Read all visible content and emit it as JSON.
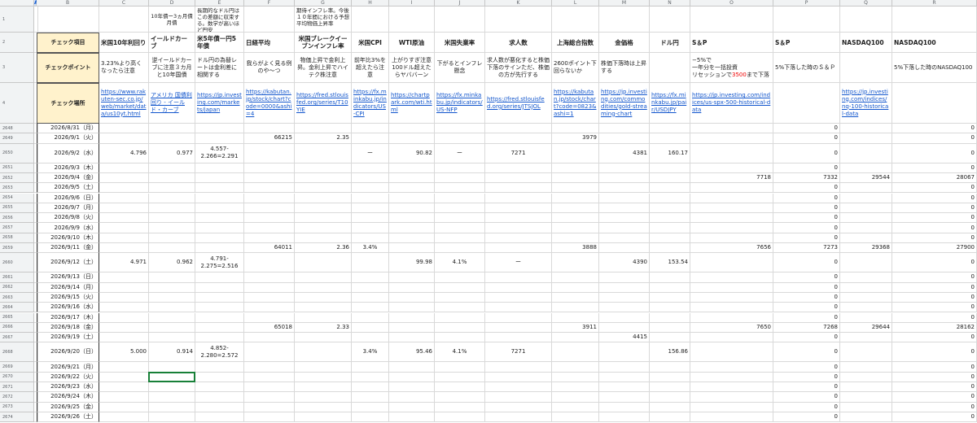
{
  "columns": [
    "A",
    "B",
    "C",
    "D",
    "E",
    "F",
    "G",
    "H",
    "I",
    "J",
    "K",
    "L",
    "M",
    "N",
    "O",
    "P",
    "Q",
    "R"
  ],
  "selected_column": "A",
  "row_numbers": [
    "1",
    "2",
    "3",
    "4",
    "2648",
    "2649",
    "2650",
    "2651",
    "2652",
    "2653",
    "2654",
    "2655",
    "2656",
    "2657",
    "2658",
    "2659",
    "2660",
    "2661",
    "2662",
    "2663",
    "2664",
    "2665",
    "2666",
    "2667",
    "2668",
    "2669",
    "2670",
    "2671",
    "2672",
    "2673",
    "2674"
  ],
  "top_notes": {
    "d": "10年債ー3ヵ月債月債",
    "e": "長期的なドル円はこの差額に収束する。数学が高いほど円安",
    "g": "期待インフレ率。今後１０年間における予想平均物価上昇率"
  },
  "headers": {
    "b": "チェック項目",
    "c": "米国10年利回り",
    "d": "イールドカーブ",
    "e": "米5年債ー円5年債",
    "f": "日経平均",
    "g": "米国ブレークイーブンインフレ率",
    "h": "米国CPI",
    "i": "WTI原油",
    "j": "米国失業率",
    "k": "求人数",
    "l": "上海総合指数",
    "m": "金価格",
    "n": "ドル円",
    "o": "S＆P",
    "p": "S＆P",
    "q": "NASDAQ100",
    "r": "NASDAQ100"
  },
  "points": {
    "b": "チェックポイント",
    "c": "3.23%より高くなったら注意",
    "d": "逆イールドカーブに注意３カ月と10年国債",
    "e": "ドル円の為替レートは金利差に相関する",
    "f": "我らがよく見る例のや〜つ",
    "g": "物価上昇で金利上昇。金利上昇でハイテク株注意",
    "h": "前年比3%を超えたら注意",
    "i": "上がりすぎ注意100ドル超えたらヤババーン",
    "j": "下がるとインフレ懸念",
    "k": "求人数が悪化すると株価下落のサインただ、株価の方が先行する",
    "l": "2600ポイント下回らないか",
    "m": "株価下落時は上昇する",
    "n": "",
    "o_line1": "−5%で",
    "o_line2": "一年分を一括投資",
    "o_line3a": "リセッションで",
    "o_line3b": "3500",
    "o_line3c": "まで下落",
    "p": "5%下落した時のＳ＆Ｐ",
    "q": "",
    "r": "5%下落した時のNASDAQ100"
  },
  "places": {
    "b": "チェック場所",
    "c": "https://www.rakuten-sec.co.jp/web/market/data/us10yt.html",
    "d": "アメリカ 国債利回り - イールド・カーブ",
    "e": "https://jp.investing.com/markets/japan",
    "f": "https://kabutan.jp/stock/chart?code=0000&ashi=4",
    "g": "https://fred.stlouisfed.org/series/T10YIE",
    "h": "https://fx.minkabu.jp/indicators/US-CPI",
    "i": "https://chartpark.com/wti.html",
    "j": "https://fx.minkabu.jp/indicators/US-NFP",
    "k": "https://fred.stlouisfed.org/series/JTSJOL",
    "l": "https://kabutan.jp/stock/chart?code=0823&ashi=1",
    "m": "https://jp.investing.com/commodities/gold-streaming-chart",
    "n": "https://fx.minkabu.jp/pair/USDJPY",
    "o": "https://jp.investing.com/indices/us-spx-500-historical-data",
    "p": "",
    "q": "https://jp.investing.com/indices/nq-100-historical-data",
    "r": ""
  },
  "rows": [
    {
      "date": "2026/8/31（月）",
      "c": "",
      "d": "",
      "e": "",
      "f": "",
      "g": "",
      "h": "",
      "i": "",
      "j": "",
      "k": "",
      "l": "",
      "m": "",
      "n": "",
      "o": "",
      "p": "0",
      "q": "",
      "r": "0"
    },
    {
      "date": "2026/9/1（火）",
      "c": "",
      "d": "",
      "e": "",
      "f": "66215",
      "g": "2.35",
      "h": "",
      "i": "",
      "j": "",
      "k": "",
      "l": "3979",
      "m": "",
      "n": "",
      "o": "",
      "p": "0",
      "q": "",
      "r": "0"
    },
    {
      "date": "2026/9/2（水）",
      "c": "4.796",
      "d": "0.977",
      "e": "4.557-2.266=2.291",
      "f": "",
      "g": "",
      "h": "ー",
      "i": "90.82",
      "j": "ー",
      "k": "7271",
      "l": "",
      "m": "4381",
      "n": "160.17",
      "o": "",
      "p": "0",
      "q": "",
      "r": "0"
    },
    {
      "date": "2026/9/3（木）",
      "c": "",
      "d": "",
      "e": "",
      "f": "",
      "g": "",
      "h": "",
      "i": "",
      "j": "",
      "k": "",
      "l": "",
      "m": "",
      "n": "",
      "o": "",
      "p": "0",
      "q": "",
      "r": "0"
    },
    {
      "date": "2026/9/4（金）",
      "c": "",
      "d": "",
      "e": "",
      "f": "",
      "g": "",
      "h": "",
      "i": "",
      "j": "",
      "k": "",
      "l": "",
      "m": "",
      "n": "",
      "o": "7718",
      "p": "7332",
      "q": "29544",
      "r": "28067"
    },
    {
      "date": "2026/9/5（土）",
      "c": "",
      "d": "",
      "e": "",
      "f": "",
      "g": "",
      "h": "",
      "i": "",
      "j": "",
      "k": "",
      "l": "",
      "m": "",
      "n": "",
      "o": "",
      "p": "0",
      "q": "",
      "r": "0"
    },
    {
      "date": "2026/9/6（日）",
      "c": "",
      "d": "",
      "e": "",
      "f": "",
      "g": "",
      "h": "",
      "i": "",
      "j": "",
      "k": "",
      "l": "",
      "m": "",
      "n": "",
      "o": "",
      "p": "0",
      "q": "",
      "r": "0"
    },
    {
      "date": "2026/9/7（月）",
      "c": "",
      "d": "",
      "e": "",
      "f": "",
      "g": "",
      "h": "",
      "i": "",
      "j": "",
      "k": "",
      "l": "",
      "m": "",
      "n": "",
      "o": "",
      "p": "0",
      "q": "",
      "r": "0"
    },
    {
      "date": "2026/9/8（火）",
      "c": "",
      "d": "",
      "e": "",
      "f": "",
      "g": "",
      "h": "",
      "i": "",
      "j": "",
      "k": "",
      "l": "",
      "m": "",
      "n": "",
      "o": "",
      "p": "0",
      "q": "",
      "r": "0"
    },
    {
      "date": "2026/9/9（水）",
      "c": "",
      "d": "",
      "e": "",
      "f": "",
      "g": "",
      "h": "",
      "i": "",
      "j": "",
      "k": "",
      "l": "",
      "m": "",
      "n": "",
      "o": "",
      "p": "0",
      "q": "",
      "r": "0"
    },
    {
      "date": "2026/9/10（木）",
      "c": "",
      "d": "",
      "e": "",
      "f": "",
      "g": "",
      "h": "",
      "i": "",
      "j": "",
      "k": "",
      "l": "",
      "m": "",
      "n": "",
      "o": "",
      "p": "0",
      "q": "",
      "r": "0"
    },
    {
      "date": "2026/9/11（金）",
      "c": "",
      "d": "",
      "e": "",
      "f": "64011",
      "g": "2.36",
      "h": "3.4%",
      "i": "",
      "j": "",
      "k": "",
      "l": "3888",
      "m": "",
      "n": "",
      "o": "7656",
      "p": "7273",
      "q": "29368",
      "r": "27900"
    },
    {
      "date": "2026/9/12（土）",
      "c": "4.971",
      "d": "0.962",
      "e": "4.791-2.275=2.516",
      "f": "",
      "g": "",
      "h": "",
      "i": "99.98",
      "j": "4.1%",
      "k": "ー",
      "l": "",
      "m": "4390",
      "n": "153.54",
      "o": "",
      "p": "0",
      "q": "",
      "r": "0"
    },
    {
      "date": "2026/9/13（日）",
      "c": "",
      "d": "",
      "e": "",
      "f": "",
      "g": "",
      "h": "",
      "i": "",
      "j": "",
      "k": "",
      "l": "",
      "m": "",
      "n": "",
      "o": "",
      "p": "0",
      "q": "",
      "r": "0"
    },
    {
      "date": "2026/9/14（月）",
      "c": "",
      "d": "",
      "e": "",
      "f": "",
      "g": "",
      "h": "",
      "i": "",
      "j": "",
      "k": "",
      "l": "",
      "m": "",
      "n": "",
      "o": "",
      "p": "0",
      "q": "",
      "r": "0"
    },
    {
      "date": "2026/9/15（火）",
      "c": "",
      "d": "",
      "e": "",
      "f": "",
      "g": "",
      "h": "",
      "i": "",
      "j": "",
      "k": "",
      "l": "",
      "m": "",
      "n": "",
      "o": "",
      "p": "0",
      "q": "",
      "r": "0"
    },
    {
      "date": "2026/9/16（水）",
      "c": "",
      "d": "",
      "e": "",
      "f": "",
      "g": "",
      "h": "",
      "i": "",
      "j": "",
      "k": "",
      "l": "",
      "m": "",
      "n": "",
      "o": "",
      "p": "0",
      "q": "",
      "r": "0"
    },
    {
      "date": "2026/9/17（木）",
      "c": "",
      "d": "",
      "e": "",
      "f": "",
      "g": "",
      "h": "",
      "i": "",
      "j": "",
      "k": "",
      "l": "",
      "m": "",
      "n": "",
      "o": "",
      "p": "0",
      "q": "",
      "r": "0"
    },
    {
      "date": "2026/9/18（金）",
      "c": "",
      "d": "",
      "e": "",
      "f": "65018",
      "g": "2.33",
      "h": "",
      "i": "",
      "j": "",
      "k": "",
      "l": "3911",
      "m": "",
      "n": "",
      "o": "7650",
      "p": "7268",
      "q": "29644",
      "r": "28162"
    },
    {
      "date": "2026/9/19（土）",
      "c": "",
      "d": "",
      "e": "",
      "f": "",
      "g": "",
      "h": "",
      "i": "",
      "j": "",
      "k": "",
      "l": "",
      "m": "4415",
      "n": "",
      "o": "",
      "p": "0",
      "q": "",
      "r": "0"
    },
    {
      "date": "2026/9/20（日）",
      "c": "5.000",
      "d": "0.914",
      "e": "4.852-2.280=2.572",
      "f": "",
      "g": "",
      "h": "3.4%",
      "i": "95.46",
      "j": "4.1%",
      "k": "7271",
      "l": "",
      "m": "",
      "n": "156.86",
      "o": "",
      "p": "0",
      "q": "",
      "r": "0"
    },
    {
      "date": "2026/9/21（月）",
      "c": "",
      "d": "",
      "e": "",
      "f": "",
      "g": "",
      "h": "",
      "i": "",
      "j": "",
      "k": "",
      "l": "",
      "m": "",
      "n": "",
      "o": "",
      "p": "0",
      "q": "",
      "r": "0"
    },
    {
      "date": "2026/9/22（火）",
      "c": "",
      "d": "",
      "e": "",
      "f": "",
      "g": "",
      "h": "",
      "i": "",
      "j": "",
      "k": "",
      "l": "",
      "m": "",
      "n": "",
      "o": "",
      "p": "0",
      "q": "",
      "r": "0"
    },
    {
      "date": "2026/9/23（水）",
      "c": "",
      "d": "",
      "e": "",
      "f": "",
      "g": "",
      "h": "",
      "i": "",
      "j": "",
      "k": "",
      "l": "",
      "m": "",
      "n": "",
      "o": "",
      "p": "0",
      "q": "",
      "r": "0"
    },
    {
      "date": "2026/9/24（木）",
      "c": "",
      "d": "",
      "e": "",
      "f": "",
      "g": "",
      "h": "",
      "i": "",
      "j": "",
      "k": "",
      "l": "",
      "m": "",
      "n": "",
      "o": "",
      "p": "0",
      "q": "",
      "r": "0"
    },
    {
      "date": "2026/9/25（金）",
      "c": "",
      "d": "",
      "e": "",
      "f": "",
      "g": "",
      "h": "",
      "i": "",
      "j": "",
      "k": "",
      "l": "",
      "m": "",
      "n": "",
      "o": "",
      "p": "0",
      "q": "",
      "r": "0"
    },
    {
      "date": "2026/9/26（土）",
      "c": "",
      "d": "",
      "e": "",
      "f": "",
      "g": "",
      "h": "",
      "i": "",
      "j": "",
      "k": "",
      "l": "",
      "m": "",
      "n": "",
      "o": "",
      "p": "0",
      "q": "",
      "r": "0"
    }
  ],
  "colors": {
    "label_bg": "#fff2cc",
    "link": "#1155cc",
    "accent_red": "#e00000",
    "selection": "#188038"
  }
}
